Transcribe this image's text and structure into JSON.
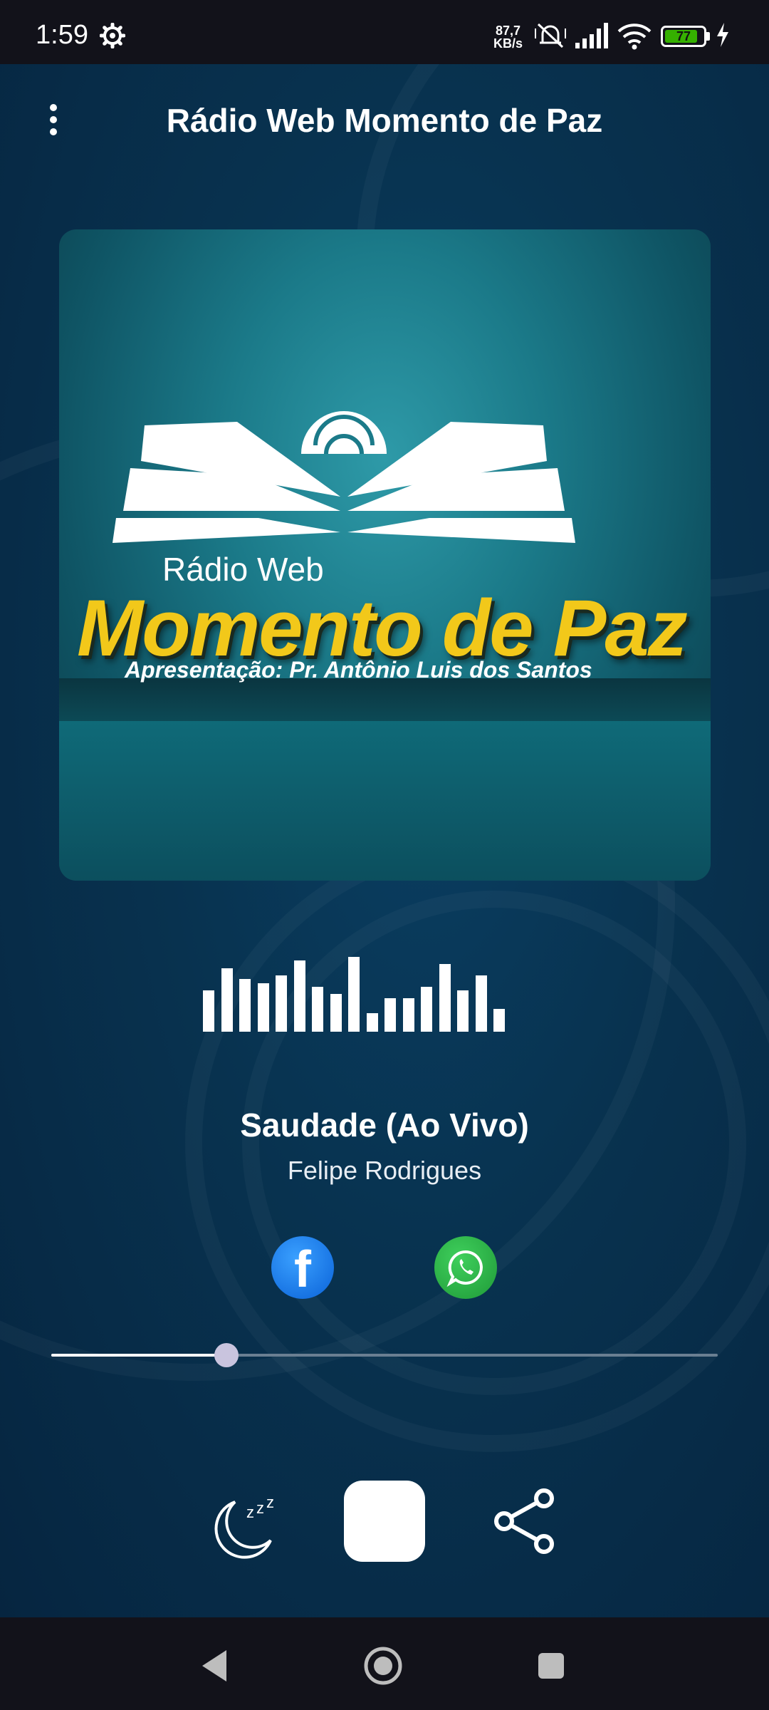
{
  "status_bar": {
    "time": "1:59",
    "net_speed_value": "87,7",
    "net_speed_unit": "KB/s",
    "battery_level": "77"
  },
  "header": {
    "title": "Rádio Web Momento de Paz"
  },
  "cover_art": {
    "line1": "Rádio Web",
    "line2": "Momento de Paz",
    "line3": "Apresentação: Pr. Antônio Luis dos Santos"
  },
  "now_playing": {
    "title": "Saudade (Ao Vivo)",
    "artist": "Felipe Rodrigues"
  },
  "social": {
    "facebook_glyph": "f"
  },
  "progress": {
    "fraction": 0.2628
  },
  "equalizer_levels": [
    0.55,
    0.85,
    0.7,
    0.65,
    0.75,
    0.95,
    0.6,
    0.5,
    1.0,
    0.25,
    0.45,
    0.45,
    0.6,
    0.9,
    0.55,
    0.75,
    0.3
  ],
  "colors": {
    "accent_thumb": "#c9c4de",
    "facebook": "#1877f2",
    "whatsapp": "#25d366",
    "cover_title": "#f2c81a"
  }
}
